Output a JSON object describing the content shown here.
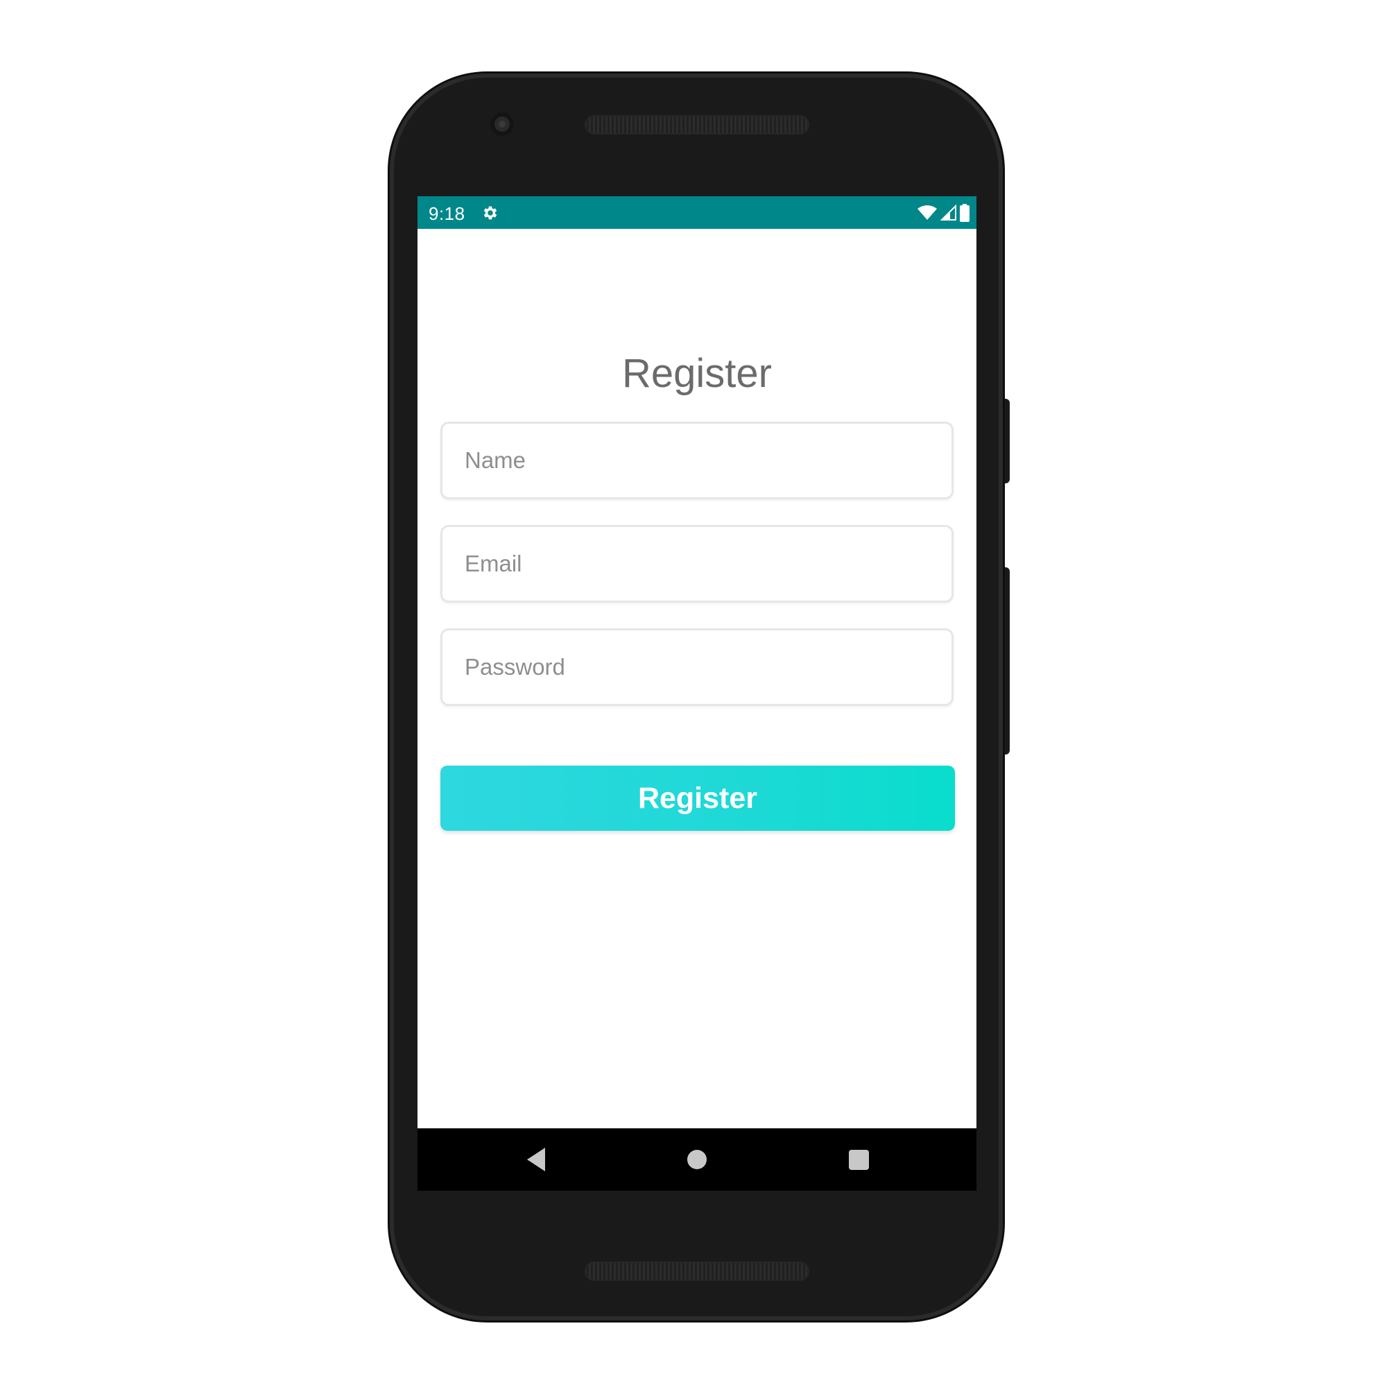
{
  "status_bar": {
    "time": "9:18",
    "background_color": "#00878a",
    "icons": [
      "settings-gear-icon",
      "wifi-icon",
      "cell-signal-icon",
      "battery-icon"
    ]
  },
  "register_form": {
    "title": "Register",
    "name_field": {
      "placeholder": "Name",
      "value": ""
    },
    "email_field": {
      "placeholder": "Email",
      "value": ""
    },
    "password_field": {
      "placeholder": "Password",
      "value": ""
    },
    "submit_label": "Register",
    "button_gradient": [
      "#2ed8df",
      "#09ddcc"
    ]
  },
  "navigation_bar": {
    "buttons": [
      "back-icon",
      "home-icon",
      "recents-icon"
    ]
  }
}
